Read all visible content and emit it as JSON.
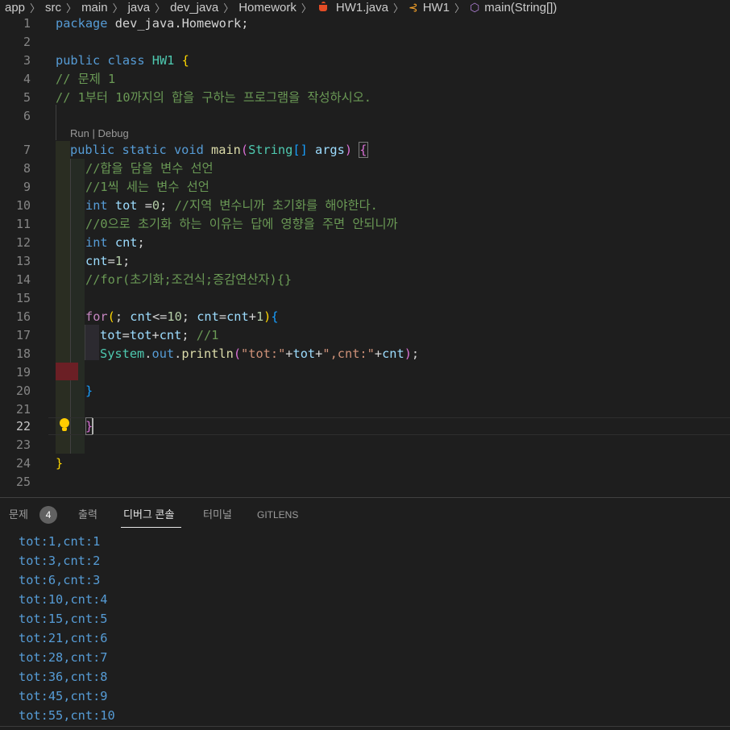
{
  "breadcrumb": {
    "items": [
      "app",
      "src",
      "main",
      "java",
      "dev_java",
      "Homework",
      "HW1.java",
      "HW1",
      "main(String[])"
    ],
    "icons": [
      "java-file-icon",
      "class-icon",
      "method-icon"
    ]
  },
  "editor": {
    "codelens": "Run | Debug",
    "line_numbers": [
      "1",
      "2",
      "3",
      "4",
      "5",
      "6",
      "7",
      "8",
      "9",
      "10",
      "11",
      "12",
      "13",
      "14",
      "15",
      "16",
      "17",
      "18",
      "19",
      "20",
      "21",
      "22",
      "23",
      "24",
      "25"
    ],
    "active_line": "22",
    "lines": {
      "l1": {
        "kw": "package",
        "pkg": "dev_java",
        "dot": ".",
        "pkg2": "Homework",
        "semi": ";"
      },
      "l3": {
        "kw1": "public",
        "kw2": "class",
        "name": "HW1",
        "brace": "{"
      },
      "l4": {
        "comment": "// 문제 1"
      },
      "l5": {
        "comment": "// 1부터 10까지의 합을 구하는 프로그램을 작성하시오."
      },
      "l7": {
        "kw1": "public",
        "kw2": "static",
        "kw3": "void",
        "fn": "main",
        "p1": "(",
        "type": "String",
        "arr": "[]",
        "arg": "args",
        "p2": ")",
        "brace": "{"
      },
      "l8": {
        "comment": "//합을 담을 변수 선언"
      },
      "l9": {
        "comment": "//1씩 세는 변수 선언"
      },
      "l10": {
        "kw": "int",
        "var": "tot",
        "op": " =",
        "num": "0",
        "semi": ";",
        "comment": "//지역 변수니까 초기화를 해야한다."
      },
      "l11": {
        "comment": "//0으로 초기화 하는 이유는 답에 영향을 주면 안되니까"
      },
      "l12": {
        "kw": "int",
        "var": "cnt",
        "semi": ";"
      },
      "l13": {
        "var": "cnt",
        "op": "=",
        "num": "1",
        "semi": ";"
      },
      "l14": {
        "comment": "//for(초기화;조건식;증감연산자){}"
      },
      "l16": {
        "kw": "for",
        "p1": "(",
        "s1": ";",
        "v1": "cnt",
        "op1": "<=",
        "n1": "10",
        "s2": ";",
        "v2": "cnt",
        "op2": "=",
        "v3": "cnt",
        "op3": "+",
        "n2": "1",
        "p2": ")",
        "brace": "{"
      },
      "l17": {
        "v1": "tot",
        "op1": "=",
        "v2": "tot",
        "op2": "+",
        "v3": "cnt",
        "semi": ";",
        "comment": "//1"
      },
      "l18": {
        "cls": "System",
        "d1": ".",
        "field": "out",
        "d2": ".",
        "fn": "println",
        "p1": "(",
        "s1": "\"tot:\"",
        "op1": "+",
        "v1": "tot",
        "op2": "+",
        "s2": "\",cnt:\"",
        "op3": "+",
        "v2": "cnt",
        "p2": ")",
        "semi": ";"
      },
      "l20": {
        "brace": "}"
      },
      "l22": {
        "brace": "}"
      },
      "l24": {
        "brace": "}"
      }
    }
  },
  "panel": {
    "tabs": [
      {
        "label": "문제",
        "badge": "4"
      },
      {
        "label": "출력"
      },
      {
        "label": "디버그 콘솔"
      },
      {
        "label": "터미널"
      },
      {
        "label": "GITLENS"
      }
    ],
    "active_tab": "디버그 콘솔",
    "output": [
      "tot:1,cnt:1",
      "tot:3,cnt:2",
      "tot:6,cnt:3",
      "tot:10,cnt:4",
      "tot:15,cnt:5",
      "tot:21,cnt:6",
      "tot:28,cnt:7",
      "tot:36,cnt:8",
      "tot:45,cnt:9",
      "tot:55,cnt:10"
    ]
  },
  "colors": {
    "background": "#1e1e1e",
    "keyword": "#569cd6",
    "control": "#c586c0",
    "class": "#4ec9b0",
    "function": "#dcdcaa",
    "variable": "#9cdcfe",
    "number": "#b5cea8",
    "string": "#ce9178",
    "comment": "#6a9955"
  }
}
